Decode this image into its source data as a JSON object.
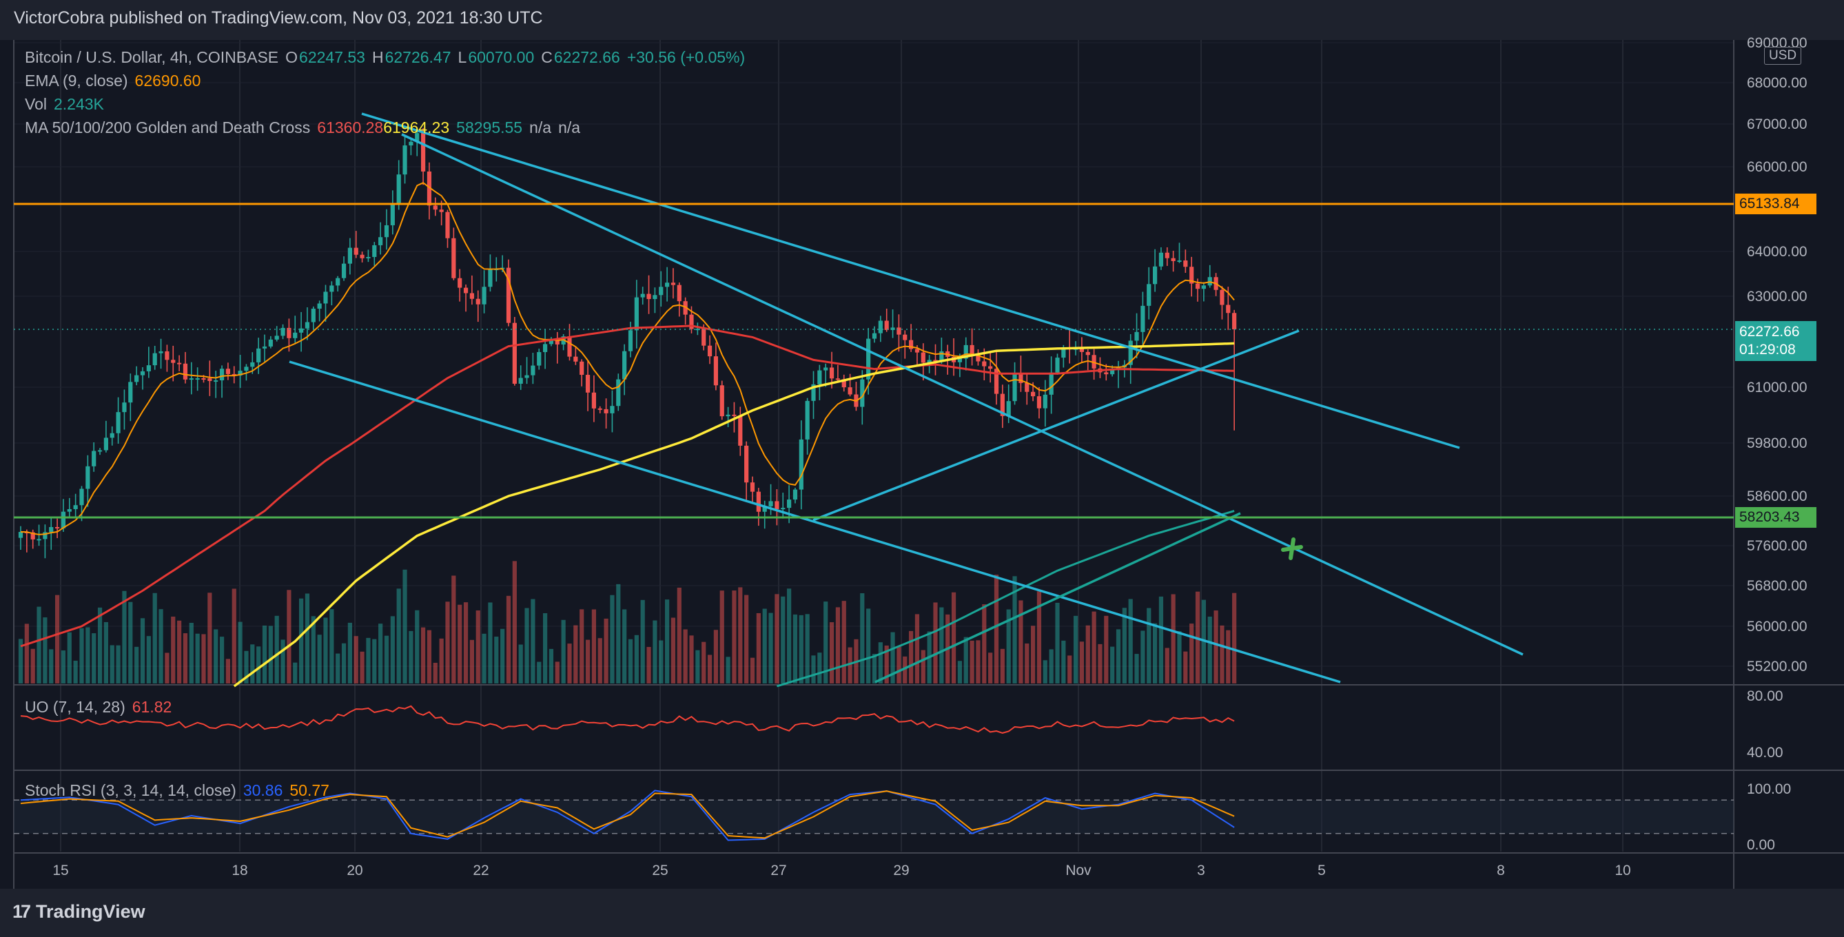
{
  "header": {
    "publisher": "VictorCobra published on TradingView.com, Nov 03, 2021 18:30 UTC"
  },
  "legend": {
    "symbol": "Bitcoin / U.S. Dollar, 4h, COINBASE",
    "o_label": "O",
    "o": "62247.53",
    "h_label": "H",
    "h": "62726.47",
    "l_label": "L",
    "l": "60070.00",
    "c_label": "C",
    "c": "62272.66",
    "change": "+30.56 (+0.05%)",
    "ema_label": "EMA (9, close)",
    "ema_value": "62690.60",
    "vol_label": "Vol",
    "vol_value": "2.243K",
    "ma_label": "MA 50/100/200 Golden and Death Cross",
    "ma_v1": "61360.28",
    "ma_v2": "61964.23",
    "ma_v3": "58295.55",
    "ma_na1": "n/a",
    "ma_na2": "n/a"
  },
  "uo": {
    "label": "UO (7, 14, 28)",
    "value": "61.82",
    "ticks": [
      "80.00",
      "40.00"
    ]
  },
  "stoch": {
    "label": "Stoch RSI (3, 3, 14, 14, close)",
    "k": "30.86",
    "d": "50.77",
    "ticks": [
      "100.00",
      "0.00"
    ]
  },
  "price_axis": {
    "currency": "USD",
    "ticks": [
      "69000.00",
      "68000.00",
      "67000.00",
      "66000.00",
      "64000.00",
      "63000.00",
      "61000.00",
      "59800.00",
      "58600.00",
      "57600.00",
      "56800.00",
      "56000.00",
      "55200.00"
    ],
    "tags": {
      "resistance": "65133.84",
      "last": "62272.66",
      "countdown": "01:29:08",
      "support": "58203.43"
    }
  },
  "time_axis": {
    "labels": [
      "15",
      "18",
      "20",
      "22",
      "25",
      "27",
      "29",
      "Nov",
      "3",
      "5",
      "8",
      "10"
    ]
  },
  "footer": {
    "brand": "TradingView"
  },
  "colors": {
    "up": "#26a69a",
    "down": "#ef5350",
    "ema": "#ff9800",
    "ma50": "#e53935",
    "ma100": "#ffeb3b",
    "trendline": "#29b6d6",
    "resistance": "#ff9800",
    "support": "#4caf50",
    "uo": "#f44336",
    "stoch_k": "#2962ff",
    "stoch_d": "#ff9800"
  },
  "chart_data": {
    "type": "candlestick",
    "timeframe": "4h",
    "ylim": [
      54800,
      69200
    ],
    "horizontal_levels": [
      65133.84,
      58203.43
    ],
    "last_price": 62272.66,
    "anchors": {
      "close": [
        [
          0,
          57880
        ],
        [
          3,
          57800
        ],
        [
          6,
          58060
        ],
        [
          9,
          58440
        ],
        [
          12,
          59580
        ],
        [
          15,
          60080
        ],
        [
          18,
          61100
        ],
        [
          21,
          61600
        ],
        [
          24,
          61700
        ],
        [
          27,
          61250
        ],
        [
          30,
          61150
        ],
        [
          33,
          61280
        ],
        [
          36,
          61350
        ],
        [
          39,
          61780
        ],
        [
          42,
          62240
        ],
        [
          45,
          62100
        ],
        [
          48,
          62700
        ],
        [
          51,
          63200
        ],
        [
          54,
          64100
        ],
        [
          57,
          63900
        ],
        [
          60,
          64500
        ],
        [
          63,
          66500
        ],
        [
          65,
          66700
        ],
        [
          67,
          65100
        ],
        [
          69,
          65000
        ],
        [
          71,
          63500
        ],
        [
          73,
          63000
        ],
        [
          75,
          62700
        ],
        [
          77,
          63500
        ],
        [
          79,
          63600
        ],
        [
          81,
          61200
        ],
        [
          83,
          61300
        ],
        [
          85,
          61800
        ],
        [
          87,
          62000
        ],
        [
          89,
          62000
        ],
        [
          91,
          61600
        ],
        [
          93,
          60900
        ],
        [
          95,
          60400
        ],
        [
          97,
          60500
        ],
        [
          99,
          61800
        ],
        [
          101,
          62900
        ],
        [
          103,
          63000
        ],
        [
          105,
          63300
        ],
        [
          107,
          63200
        ],
        [
          109,
          62500
        ],
        [
          111,
          62200
        ],
        [
          113,
          61800
        ],
        [
          115,
          60500
        ],
        [
          117,
          60300
        ],
        [
          119,
          59000
        ],
        [
          121,
          58400
        ],
        [
          123,
          58500
        ],
        [
          125,
          58400
        ],
        [
          127,
          58800
        ],
        [
          129,
          60800
        ],
        [
          131,
          61500
        ],
        [
          133,
          61300
        ],
        [
          135,
          61100
        ],
        [
          137,
          60600
        ],
        [
          139,
          62000
        ],
        [
          141,
          62400
        ],
        [
          143,
          62200
        ],
        [
          145,
          62000
        ],
        [
          147,
          61800
        ],
        [
          149,
          61500
        ],
        [
          151,
          61900
        ],
        [
          153,
          61600
        ],
        [
          155,
          61900
        ],
        [
          157,
          61600
        ],
        [
          159,
          61300
        ],
        [
          161,
          60400
        ],
        [
          163,
          61200
        ],
        [
          165,
          60900
        ],
        [
          167,
          60500
        ],
        [
          169,
          61200
        ],
        [
          171,
          61900
        ],
        [
          173,
          61800
        ],
        [
          175,
          61600
        ],
        [
          177,
          61200
        ],
        [
          179,
          61300
        ],
        [
          181,
          61600
        ],
        [
          183,
          62200
        ],
        [
          185,
          63300
        ],
        [
          187,
          63900
        ],
        [
          189,
          63800
        ],
        [
          191,
          63600
        ],
        [
          193,
          63200
        ],
        [
          195,
          63300
        ],
        [
          197,
          62900
        ],
        [
          199,
          62273
        ]
      ]
    },
    "uo_anchors": [
      [
        0,
        64
      ],
      [
        10,
        62
      ],
      [
        20,
        60
      ],
      [
        30,
        59
      ],
      [
        40,
        58
      ],
      [
        50,
        62
      ],
      [
        56,
        70
      ],
      [
        60,
        68
      ],
      [
        64,
        71
      ],
      [
        70,
        62
      ],
      [
        80,
        57
      ],
      [
        88,
        58
      ],
      [
        95,
        62
      ],
      [
        100,
        57
      ],
      [
        108,
        64
      ],
      [
        118,
        60
      ],
      [
        122,
        56
      ],
      [
        126,
        57
      ],
      [
        130,
        60
      ],
      [
        140,
        66
      ],
      [
        150,
        58
      ],
      [
        160,
        55
      ],
      [
        170,
        60
      ],
      [
        180,
        59
      ],
      [
        190,
        63
      ],
      [
        199,
        62
      ]
    ],
    "stoch_k_anchors": [
      [
        0,
        80
      ],
      [
        8,
        85
      ],
      [
        16,
        72
      ],
      [
        22,
        35
      ],
      [
        28,
        52
      ],
      [
        36,
        38
      ],
      [
        44,
        68
      ],
      [
        50,
        85
      ],
      [
        54,
        92
      ],
      [
        60,
        82
      ],
      [
        64,
        20
      ],
      [
        70,
        10
      ],
      [
        76,
        48
      ],
      [
        82,
        82
      ],
      [
        88,
        58
      ],
      [
        94,
        20
      ],
      [
        100,
        60
      ],
      [
        104,
        97
      ],
      [
        110,
        86
      ],
      [
        116,
        8
      ],
      [
        122,
        10
      ],
      [
        130,
        58
      ],
      [
        136,
        90
      ],
      [
        142,
        96
      ],
      [
        150,
        72
      ],
      [
        156,
        20
      ],
      [
        162,
        46
      ],
      [
        168,
        84
      ],
      [
        174,
        64
      ],
      [
        180,
        72
      ],
      [
        186,
        92
      ],
      [
        192,
        80
      ],
      [
        199,
        31
      ]
    ],
    "stoch_d_anchors": [
      [
        0,
        74
      ],
      [
        8,
        82
      ],
      [
        16,
        78
      ],
      [
        22,
        44
      ],
      [
        28,
        48
      ],
      [
        36,
        42
      ],
      [
        44,
        62
      ],
      [
        50,
        82
      ],
      [
        54,
        90
      ],
      [
        60,
        86
      ],
      [
        64,
        30
      ],
      [
        70,
        14
      ],
      [
        76,
        40
      ],
      [
        82,
        78
      ],
      [
        88,
        66
      ],
      [
        94,
        28
      ],
      [
        100,
        54
      ],
      [
        104,
        92
      ],
      [
        110,
        90
      ],
      [
        116,
        16
      ],
      [
        122,
        12
      ],
      [
        130,
        50
      ],
      [
        136,
        86
      ],
      [
        142,
        96
      ],
      [
        150,
        78
      ],
      [
        156,
        26
      ],
      [
        162,
        40
      ],
      [
        168,
        78
      ],
      [
        174,
        70
      ],
      [
        180,
        70
      ],
      [
        186,
        88
      ],
      [
        192,
        84
      ],
      [
        199,
        51
      ]
    ]
  }
}
